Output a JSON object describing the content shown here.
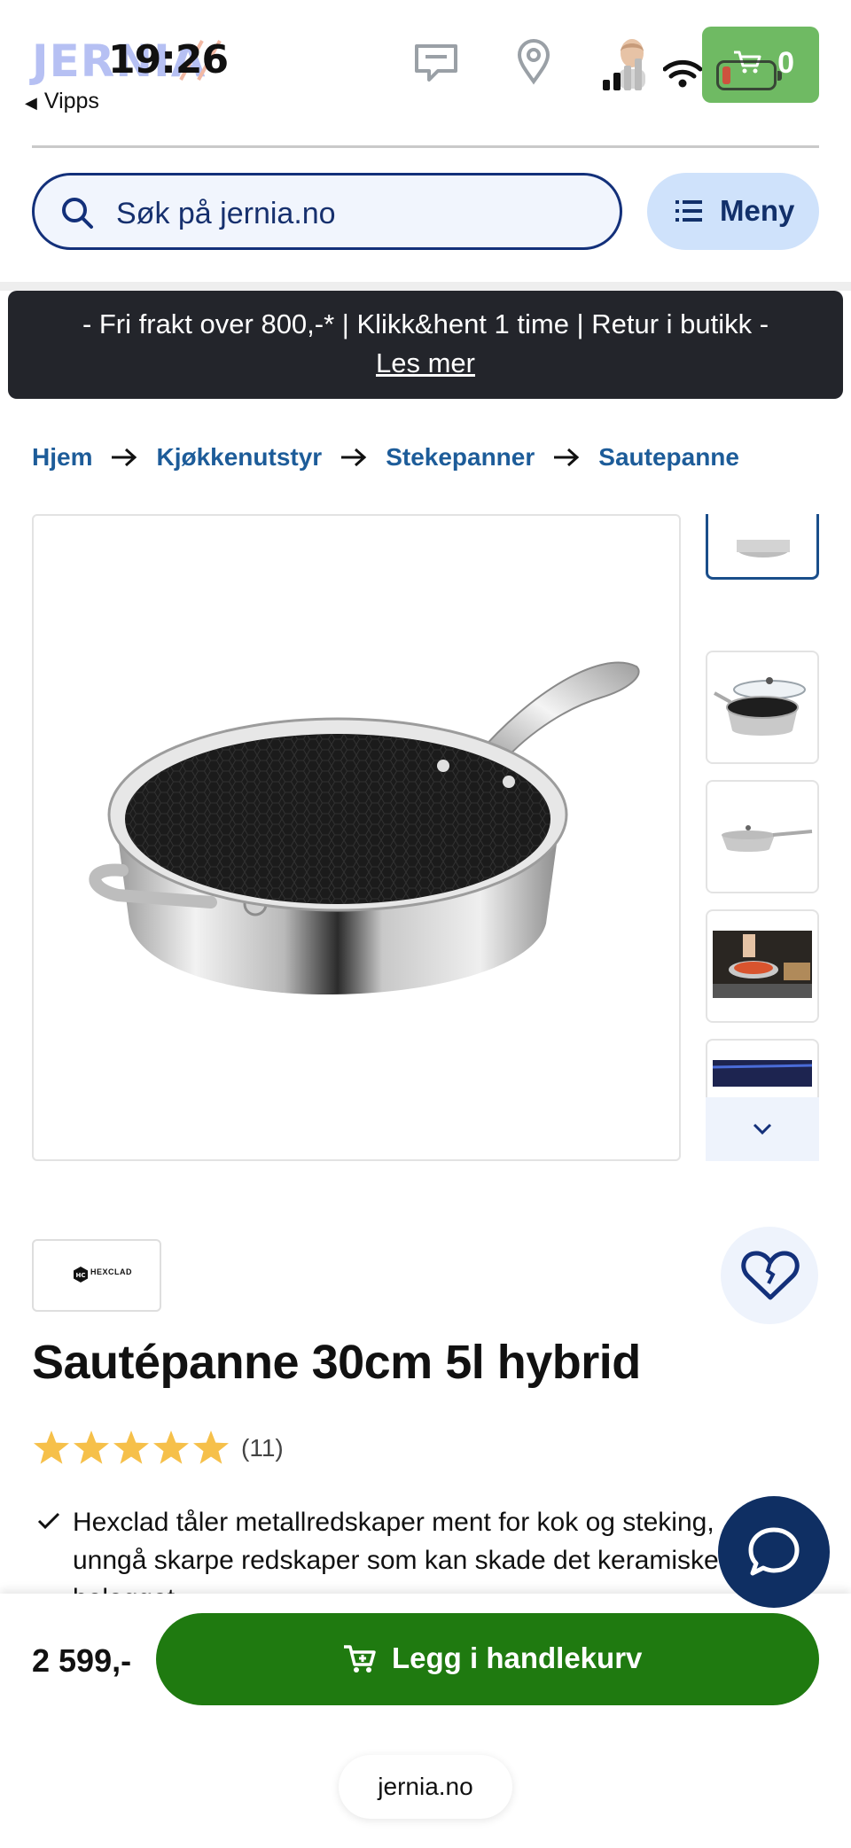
{
  "status_bar": {
    "time": "19:26",
    "back_app": "Vipps"
  },
  "header": {
    "logo_text": "JERNIA",
    "cart_count": "0",
    "search_placeholder": "Søk på jernia.no",
    "menu_label": "Meny"
  },
  "banner": {
    "line1": "- Fri frakt over 800,-* | Klikk&hent 1 time | Retur i butikk -",
    "link": "Les mer"
  },
  "breadcrumb": [
    "Hjem",
    "Kjøkkenutstyr",
    "Stekepanner",
    "Sautepanne"
  ],
  "product": {
    "brand_logo_text": "HEXCLAD",
    "title": "Sautépanne 30cm 5l hybrid",
    "rating_stars": 5,
    "rating_count": "(11)",
    "bullet_1": "Hexclad tåler metallredskaper ment for kok og steking, unngå skarpe redskaper som kan skade det keramiske belegget.",
    "price": "2 599,-",
    "add_to_cart_label": "Legg i handlekurv"
  },
  "footer": {
    "domain": "jernia.no"
  },
  "colors": {
    "brand_blue": "#13307a",
    "link_blue": "#1d5c99",
    "primary_green": "#1f7a10",
    "banner_bg": "#23252b",
    "star_yellow": "#f6c04a"
  }
}
